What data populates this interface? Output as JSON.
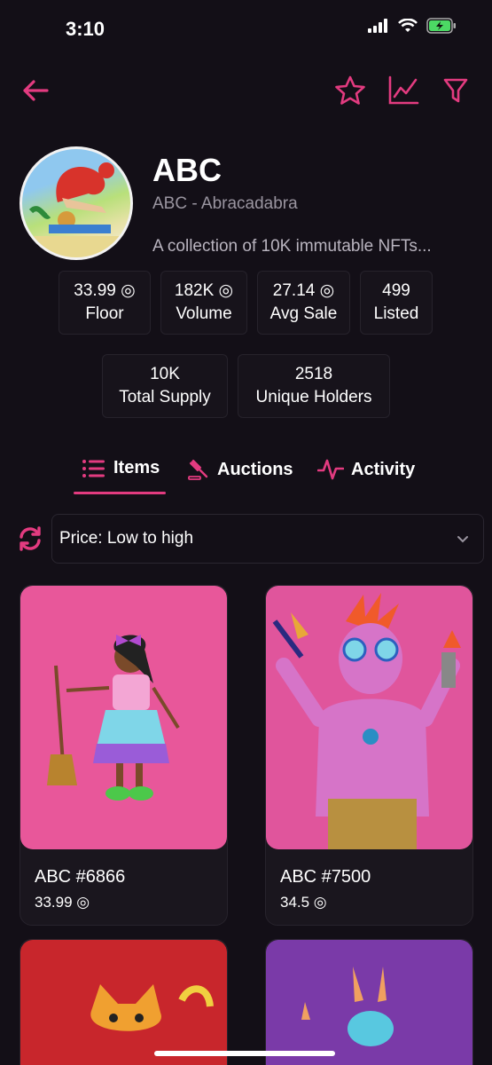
{
  "status": {
    "time": "3:10"
  },
  "collection": {
    "title": "ABC",
    "subtitle": "ABC - Abracadabra",
    "description": "A collection of 10K immutable NFTs..."
  },
  "stats": [
    {
      "value": "33.99 ◎",
      "label": "Floor"
    },
    {
      "value": "182K ◎",
      "label": "Volume"
    },
    {
      "value": "27.14 ◎",
      "label": "Avg Sale"
    },
    {
      "value": "499",
      "label": "Listed"
    },
    {
      "value": "10K",
      "label": "Total Supply"
    },
    {
      "value": "2518",
      "label": "Unique Holders"
    }
  ],
  "tabs": [
    {
      "label": "Items",
      "icon": "list-icon",
      "active": true
    },
    {
      "label": "Auctions",
      "icon": "gavel-icon",
      "active": false
    },
    {
      "label": "Activity",
      "icon": "activity-icon",
      "active": false
    }
  ],
  "sort": {
    "selected": "Price: Low to high"
  },
  "items": [
    {
      "name": "ABC #6866",
      "price": "33.99 ◎",
      "bg": "#e8579a"
    },
    {
      "name": "ABC #7500",
      "price": "34.5 ◎",
      "bg": "#e0559c"
    },
    {
      "name": "",
      "price": "",
      "bg": "#c8262c"
    },
    {
      "name": "",
      "price": "",
      "bg": "#7a3aa8"
    }
  ],
  "colors": {
    "accent": "#e33b80",
    "background": "#130f17"
  }
}
